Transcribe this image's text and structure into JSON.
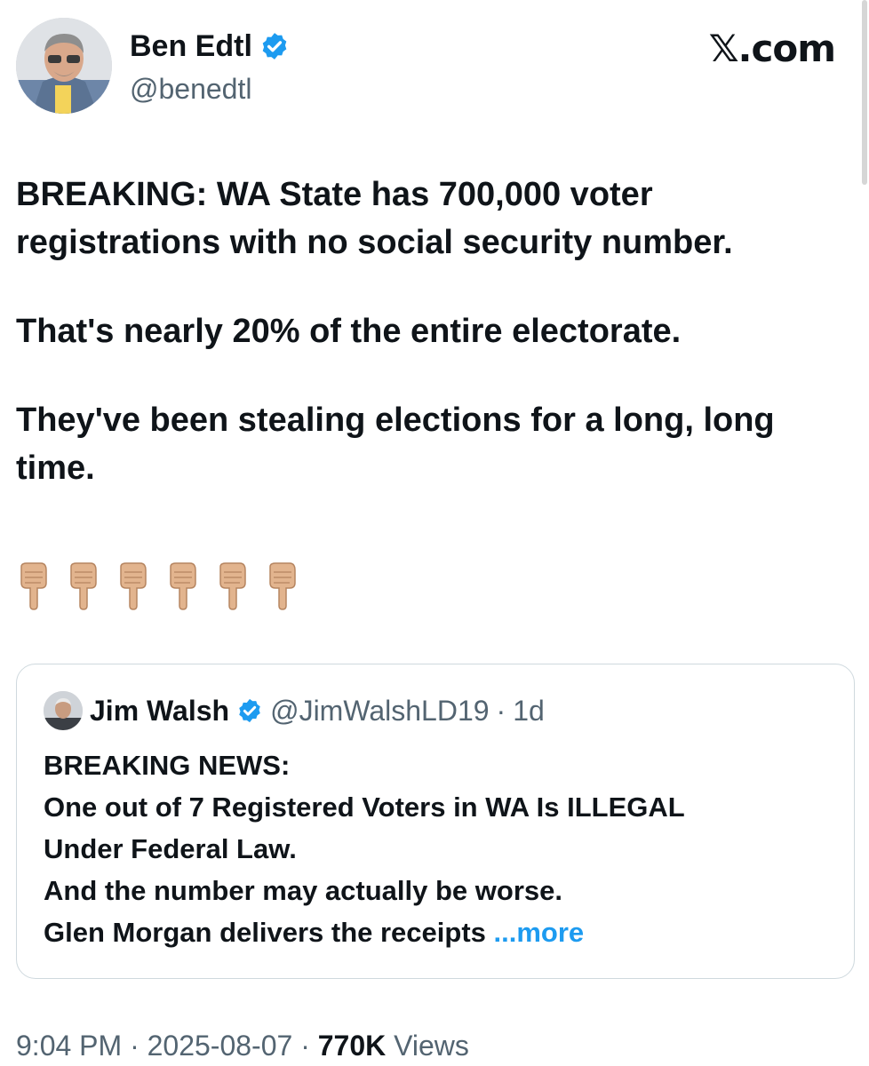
{
  "author": {
    "name": "Ben Edtl",
    "handle": "@benedtl",
    "verified_color": "#1d9bf0"
  },
  "brand": "𝕏.com",
  "tweet": {
    "paragraphs": [
      "BREAKING: WA State has 700,000 voter registrations with no social security number.",
      "That's nearly 20% of the entire electorate.",
      "They've been stealing elections for a long, long time."
    ],
    "emoji_icons": [
      "pointing-down-icon",
      "pointing-down-icon",
      "pointing-down-icon",
      "pointing-down-icon",
      "pointing-down-icon",
      "pointing-down-icon"
    ]
  },
  "quote": {
    "name": "Jim Walsh",
    "handle": "@JimWalshLD19",
    "separator": "·",
    "age": "1d",
    "lines": [
      "BREAKING NEWS:",
      "One out of 7 Registered Voters in WA Is ILLEGAL",
      "Under Federal Law.",
      "And the number may actually be worse.",
      "Glen Morgan delivers the receipts"
    ],
    "more_label": "...more"
  },
  "meta": {
    "time": "9:04 PM",
    "sep1": " · ",
    "date": "2025-08-07",
    "sep2": " · ",
    "views_count": "770K",
    "views_label": " Views"
  },
  "colors": {
    "text": "#0f1419",
    "muted": "#536471",
    "link": "#1d9bf0",
    "border": "#cfd9de"
  }
}
